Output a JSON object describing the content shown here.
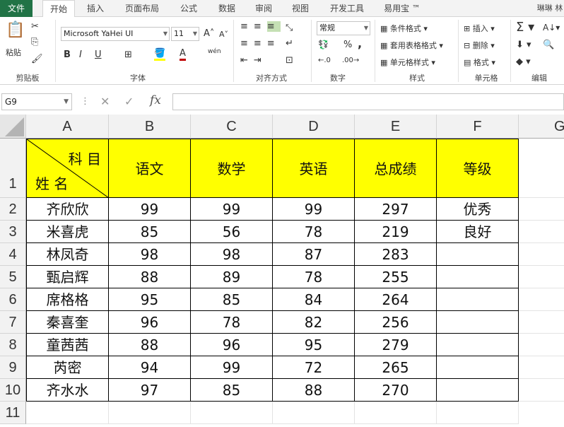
{
  "ribbon_tabs": [
    "文件",
    "开始",
    "插入",
    "页面布局",
    "公式",
    "数据",
    "审阅",
    "视图",
    "开发工具",
    "易用宝 ™"
  ],
  "user": "琳琳 林",
  "clipboard": {
    "paste_label": "粘贴",
    "group": "剪贴板"
  },
  "font": {
    "name": "Microsoft YaHei UI",
    "size": "11",
    "group": "字体",
    "bold": "B",
    "italic": "I",
    "underline": "U",
    "font_color_glyph": "A",
    "wen": "wén",
    "grow": "A",
    "shrink": "A"
  },
  "alignment": {
    "group": "对齐方式"
  },
  "number": {
    "format": "常规",
    "group": "数字",
    "percent": "%",
    "comma": ","
  },
  "styles": {
    "conditional": "条件格式",
    "table": "套用表格格式",
    "cell": "单元格样式",
    "group": "样式"
  },
  "cells": {
    "insert": "插入",
    "delete": "删除",
    "format": "格式",
    "group": "单元格"
  },
  "editing": {
    "group": "编辑"
  },
  "formula_bar": {
    "name_box": "G9",
    "fx": "fx",
    "value": ""
  },
  "columns": [
    "A",
    "B",
    "C",
    "D",
    "E",
    "F",
    "G"
  ],
  "rows": [
    "1",
    "2",
    "3",
    "4",
    "5",
    "6",
    "7",
    "8",
    "9",
    "10",
    "11"
  ],
  "header": {
    "diag_top": "科 目",
    "diag_bottom": "姓 名",
    "subjects": [
      "语文",
      "数学",
      "英语",
      "总成绩",
      "等级"
    ]
  },
  "table": [
    [
      "齐欣欣",
      "99",
      "99",
      "99",
      "297",
      "优秀"
    ],
    [
      "米喜虎",
      "85",
      "56",
      "78",
      "219",
      "良好"
    ],
    [
      "林凤奇",
      "98",
      "98",
      "87",
      "283",
      ""
    ],
    [
      "甄启辉",
      "88",
      "89",
      "78",
      "255",
      ""
    ],
    [
      "席格格",
      "95",
      "85",
      "84",
      "264",
      ""
    ],
    [
      "秦喜奎",
      "96",
      "78",
      "82",
      "256",
      ""
    ],
    [
      "童茜茜",
      "88",
      "96",
      "95",
      "279",
      ""
    ],
    [
      "芮密",
      "94",
      "99",
      "72",
      "265",
      ""
    ],
    [
      "齐水水",
      "97",
      "85",
      "88",
      "270",
      ""
    ]
  ],
  "colors": {
    "accent": "#217346",
    "header_fill": "#ffff00"
  }
}
